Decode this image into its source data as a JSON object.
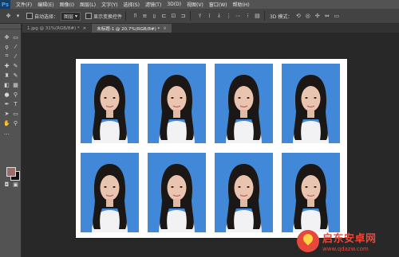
{
  "menubar": {
    "logo": "Ps",
    "items": [
      "文件(F)",
      "编辑(E)",
      "图像(I)",
      "图层(L)",
      "文字(Y)",
      "选择(S)",
      "滤镜(T)",
      "3D(D)",
      "视图(V)",
      "窗口(W)",
      "帮助(H)"
    ]
  },
  "options": {
    "auto_select_label": "自动选择：",
    "auto_select_value": "图层",
    "transform_label": "显示变换控件",
    "mode_3d_label": "3D 模式："
  },
  "tabs": [
    {
      "label": "1.jpg @ 31%(RGB/8#) *",
      "close": "×"
    },
    {
      "label": "未标题-1 @ 20.7%(RGB/8#) *",
      "close": "×"
    }
  ],
  "colors": {
    "foreground": "#9c6b68",
    "background": "#111111",
    "photo_bg": "#4188d8"
  },
  "watermark": {
    "title": "启东安卓网",
    "url": "www.qdazw.com"
  }
}
